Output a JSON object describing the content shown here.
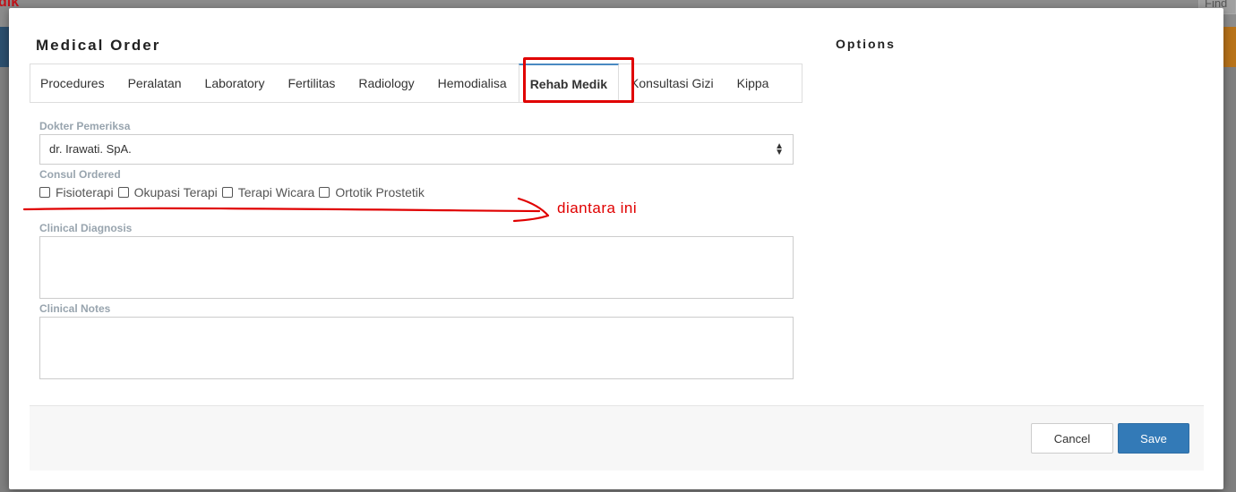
{
  "background": {
    "logo_text": "dik",
    "find_text": "Find"
  },
  "modal": {
    "title": "Medical Order",
    "options_title": "Options",
    "tabs": [
      {
        "label": "Procedures"
      },
      {
        "label": "Peralatan"
      },
      {
        "label": "Laboratory"
      },
      {
        "label": "Fertilitas"
      },
      {
        "label": "Radiology"
      },
      {
        "label": "Hemodialisa"
      },
      {
        "label": "Rehab Medik",
        "active": true
      },
      {
        "label": "Konsultasi Gizi"
      },
      {
        "label": "Kippa"
      }
    ],
    "form": {
      "doctor_label": "Dokter Pemeriksa",
      "doctor_value": "dr. Irawati. SpA.",
      "consul_label": "Consul Ordered",
      "consul_options": [
        "Fisioterapi",
        "Okupasi Terapi",
        "Terapi Wicara",
        "Ortotik Prostetik"
      ],
      "diagnosis_label": "Clinical Diagnosis",
      "notes_label": "Clinical Notes"
    },
    "footer": {
      "cancel_label": "Cancel",
      "save_label": "Save"
    }
  },
  "annotation": {
    "text": "diantara ini",
    "color": "#e00000"
  },
  "colors": {
    "accent": "#337ab7",
    "tab_active_border": "#4a8ac2",
    "label": "#98a4ae"
  }
}
